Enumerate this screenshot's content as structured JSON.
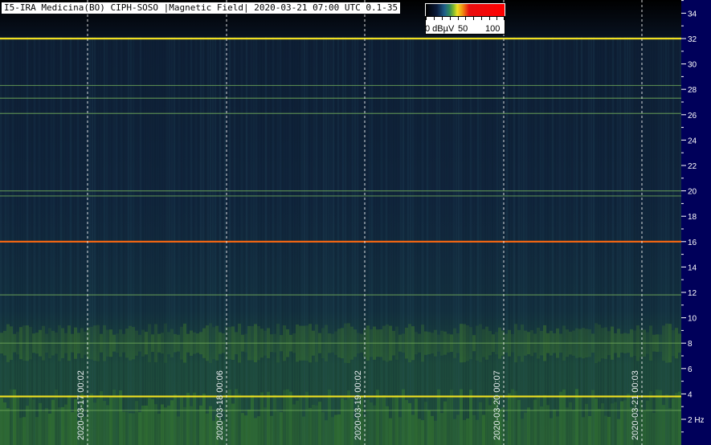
{
  "header": {
    "title": "I5-IRA Medicina(BO) CIPH-SOSO |Magnetic Field| 2020-03-21 07:00 UTC 0.1-35"
  },
  "colorbar": {
    "label_zero": "0 dBµV",
    "label_50": "50",
    "label_100": "100"
  },
  "chart_data": {
    "type": "heatmap",
    "title": "I5-IRA Medicina(BO) CIPH-SOSO |Magnetic Field| 2020-03-21 07:00 UTC 0.1-35",
    "ylabel": "Hz",
    "ylim": [
      0.1,
      35
    ],
    "y_ticks": [
      "2 Hz",
      "4",
      "6",
      "8",
      "10",
      "12",
      "14",
      "16",
      "18",
      "20",
      "22",
      "24",
      "26",
      "28",
      "30",
      "32",
      "34"
    ],
    "x_markers": [
      "2020-03-17 00:02",
      "2020-03-18 00:06",
      "2020-03-19 00:02",
      "2020-03-20 00:07",
      "2020-03-21 00:03"
    ],
    "colorbar": {
      "unit": "dBµV",
      "range": [
        0,
        100
      ]
    },
    "strong_lines_hz": [
      {
        "freq": 32,
        "color": "#f0e020"
      },
      {
        "freq": 16,
        "color": "#ff6a10"
      },
      {
        "freq": 3.8,
        "color": "#f0e020"
      }
    ],
    "weak_lines_hz": [
      28.3,
      27.3,
      26.1,
      20,
      19.6,
      11.8,
      8,
      2.7
    ]
  }
}
